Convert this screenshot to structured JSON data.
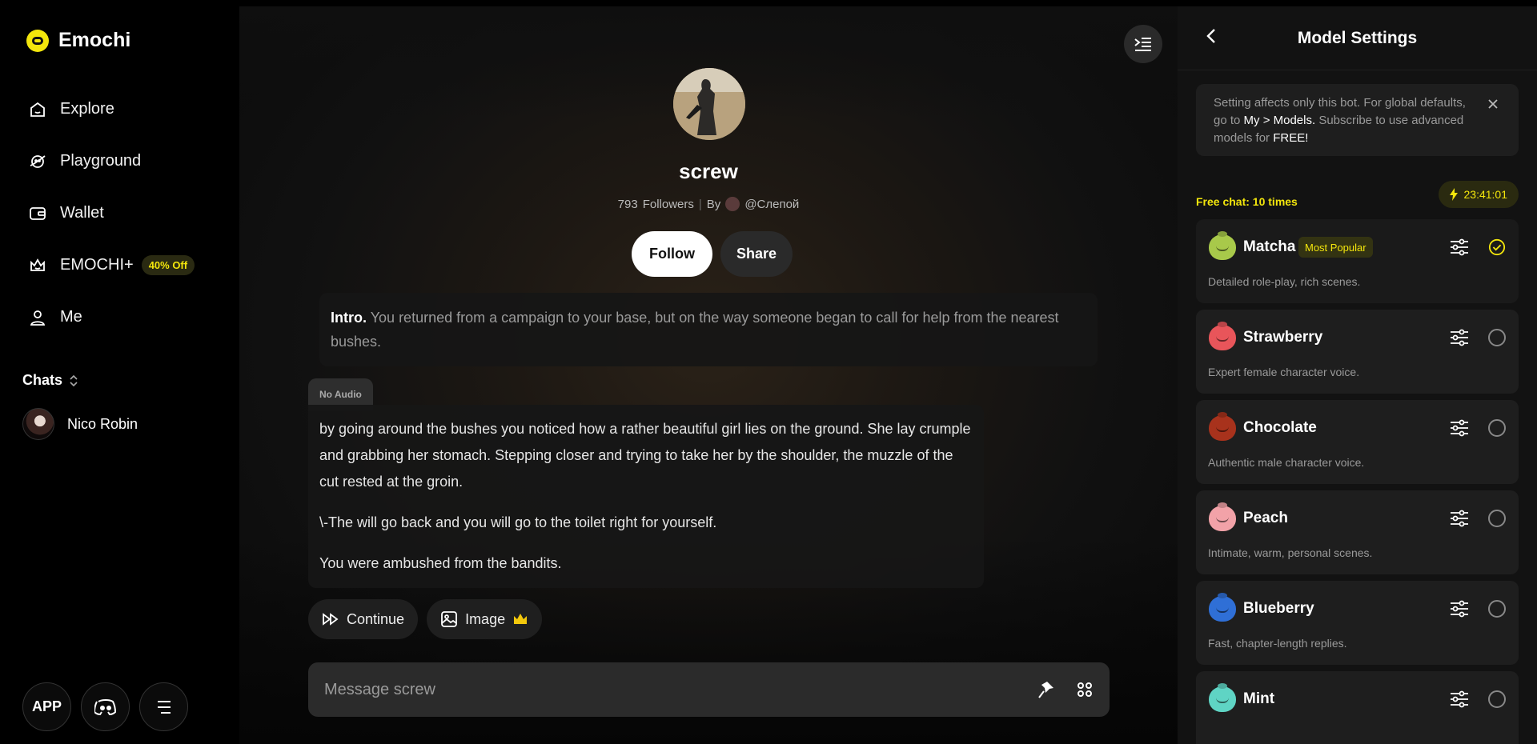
{
  "brand": {
    "name": "Emochi",
    "accent": "#f3e60c"
  },
  "nav": {
    "items": [
      {
        "label": "Explore",
        "icon": "home-icon"
      },
      {
        "label": "Playground",
        "icon": "planet-icon"
      },
      {
        "label": "Wallet",
        "icon": "wallet-icon"
      },
      {
        "label": "EMOCHI+",
        "icon": "crown-icon",
        "badge": "40% Off"
      },
      {
        "label": "Me",
        "icon": "user-icon"
      }
    ]
  },
  "chats": {
    "heading": "Chats",
    "items": [
      {
        "name": "Nico Robin"
      }
    ]
  },
  "bottom": {
    "app_label": "APP"
  },
  "bot": {
    "name": "screw",
    "followers_count": "793",
    "followers_label": "Followers",
    "by_label": "By",
    "author": "@Слепой",
    "follow_label": "Follow",
    "share_label": "Share",
    "intro_label": "Intro.",
    "intro_text": "You returned from a campaign to your base, but on the way someone began to call for help from the nearest bushes."
  },
  "message": {
    "audio_tag": "No Audio",
    "paragraphs": [
      "by going around the bushes you noticed how a rather beautiful girl lies on the ground. She lay crumple and grabbing her stomach. Stepping closer and trying to take her by the shoulder, the muzzle of the cut rested at the groin.",
      "\\-The will go back and you will go to the toilet right for yourself.",
      "You were ambushed from the bandits."
    ]
  },
  "actions": {
    "continue_label": "Continue",
    "image_label": "Image"
  },
  "composer": {
    "placeholder": "Message screw"
  },
  "panel": {
    "title": "Model Settings",
    "notice": {
      "part1": "Setting affects only this bot. For global defaults, go to ",
      "link": "My > Models.",
      "part2": " Subscribe to use advanced models for ",
      "free": "FREE!"
    },
    "free_chat": "Free chat: 10 times",
    "timer": "23:41:01",
    "models": [
      {
        "name": "Matcha",
        "tag": "Most Popular",
        "desc": "Detailed role-play, rich scenes.",
        "color": "#a8c94a",
        "selected": true
      },
      {
        "name": "Strawberry",
        "tag": "",
        "desc": "Expert female character voice.",
        "color": "#e8555a",
        "selected": false
      },
      {
        "name": "Chocolate",
        "tag": "",
        "desc": "Authentic male character voice.",
        "color": "#a8321c",
        "selected": false
      },
      {
        "name": "Peach",
        "tag": "",
        "desc": "Intimate, warm, personal scenes.",
        "color": "#f2a2a8",
        "selected": false
      },
      {
        "name": "Blueberry",
        "tag": "",
        "desc": "Fast, chapter-length replies.",
        "color": "#2f6fd6",
        "selected": false
      },
      {
        "name": "Mint",
        "tag": "",
        "desc": "",
        "color": "#5fd4c4",
        "selected": false
      }
    ]
  }
}
